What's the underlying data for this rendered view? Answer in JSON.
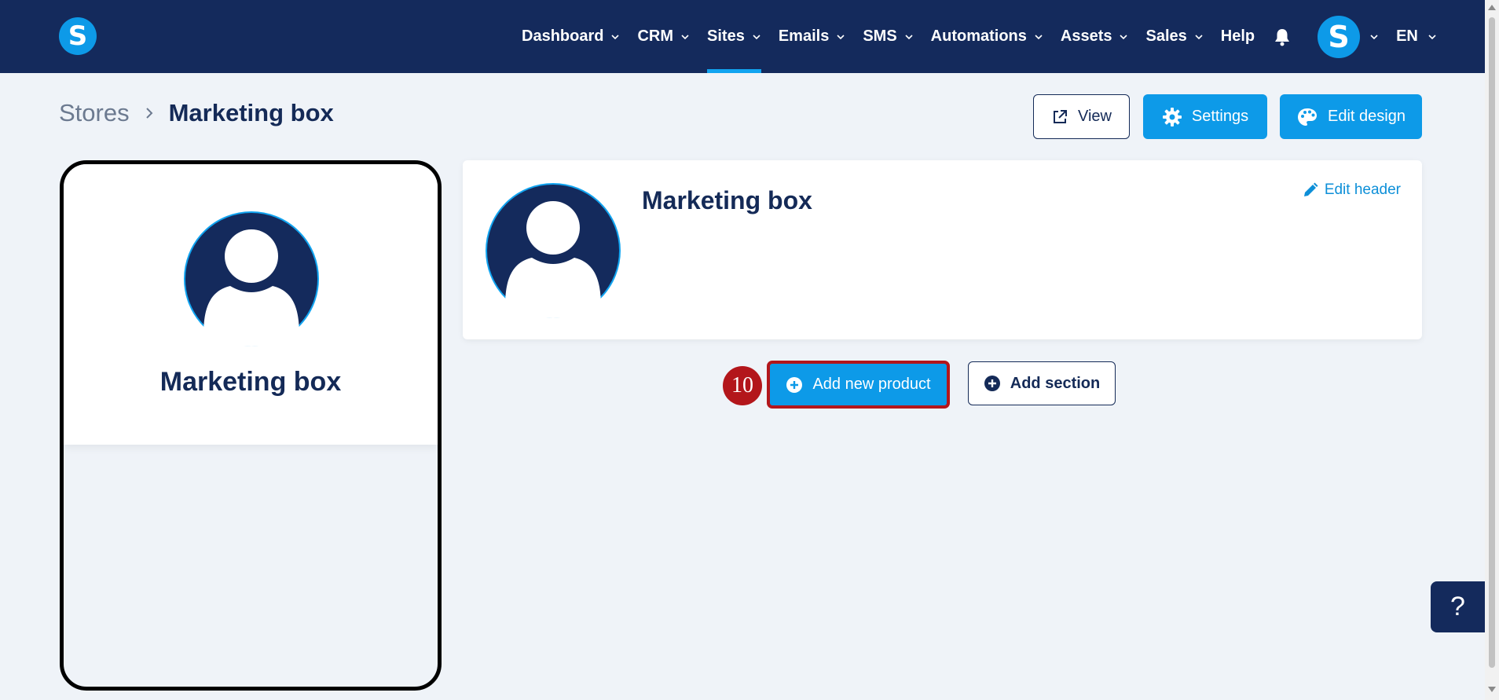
{
  "nav": {
    "logo_letter": "S",
    "items": [
      {
        "label": "Dashboard",
        "has_menu": true
      },
      {
        "label": "CRM",
        "has_menu": true
      },
      {
        "label": "Sites",
        "has_menu": true,
        "active": true
      },
      {
        "label": "Emails",
        "has_menu": true
      },
      {
        "label": "SMS",
        "has_menu": true
      },
      {
        "label": "Automations",
        "has_menu": true
      },
      {
        "label": "Assets",
        "has_menu": true
      },
      {
        "label": "Sales",
        "has_menu": true
      },
      {
        "label": "Help",
        "has_menu": false
      }
    ],
    "avatar_letter": "S",
    "language": "EN"
  },
  "breadcrumb": {
    "root": "Stores",
    "current": "Marketing box"
  },
  "toolbar": {
    "view_label": "View",
    "settings_label": "Settings",
    "edit_design_label": "Edit design"
  },
  "preview": {
    "store_name": "Marketing box"
  },
  "header_card": {
    "store_name": "Marketing box",
    "edit_label": "Edit header"
  },
  "actions": {
    "step_number": "10",
    "add_product_label": "Add new product",
    "add_section_label": "Add section"
  },
  "help": {
    "label": "?"
  },
  "colors": {
    "navbar": "#142a5c",
    "accent": "#0d9ae8",
    "background": "#eff3f8",
    "highlight": "#b3161b"
  }
}
